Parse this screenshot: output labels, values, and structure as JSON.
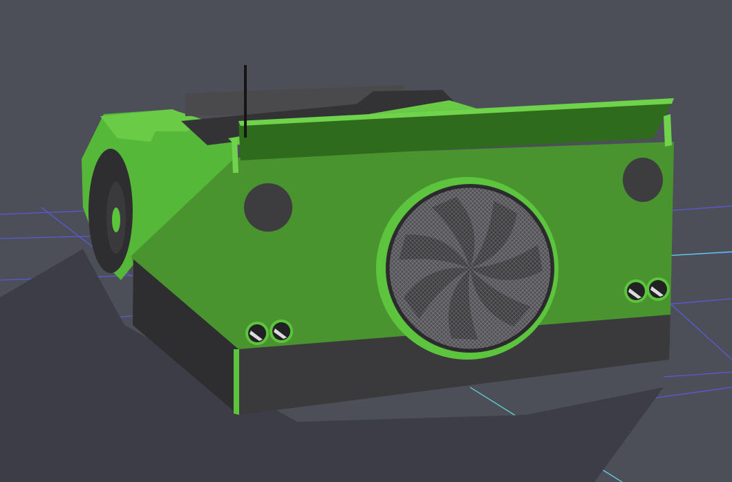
{
  "viewport": {
    "background_color": "#4d4f58",
    "ground_shadow_color": "#3c3d47",
    "grid_color": "#5a5ad8",
    "grid_axis_x_color": "#5fd6d6",
    "grid_axis_y_color": "#5fd6d6"
  },
  "model": {
    "body_color": "#49942f",
    "body_light_color": "#5cc43d",
    "body_side_color": "#55b838",
    "body_top_color": "#6acb46",
    "wing_color": "#2f6b1d",
    "wing_edge_color": "#6fd34c",
    "skirt_color": "#3a3a3c",
    "skirt_dark_color": "#2e2e30",
    "sensor_color": "#3d3d40",
    "fan_grille_color": "#5a5a5e",
    "fan_blade_color": "#2b2b2d",
    "knob_face_color": "#222224",
    "knob_highlight_color": "#dcdcdc",
    "antenna_color": "#151515",
    "cockpit_color": "#333335",
    "cockpit_panel_color": "#4a4a4d"
  }
}
